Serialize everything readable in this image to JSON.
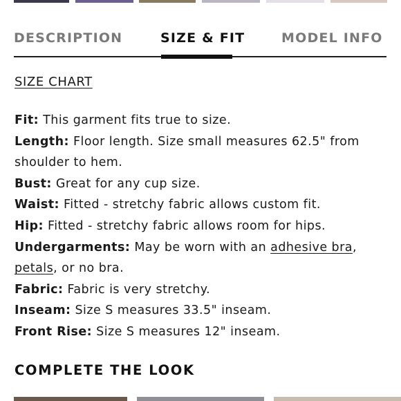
{
  "tabs": {
    "description": "DESCRIPTION",
    "size_fit": "SIZE & FIT",
    "model_info": "MODEL INFO",
    "active": "size_fit"
  },
  "size_chart_link": "SIZE CHART",
  "details": {
    "fit": {
      "label": "Fit:",
      "text": "This garment fits true to size."
    },
    "length": {
      "label": "Length:",
      "text_line1": "Floor length. Size small measures 62.5\" from",
      "text_line2": "shoulder to hem."
    },
    "bust": {
      "label": "Bust:",
      "text": "Great for any cup size."
    },
    "waist": {
      "label": "Waist:",
      "text": "Fitted - stretchy fabric allows custom fit."
    },
    "hip": {
      "label": "Hip:",
      "text": "Fitted - stretchy fabric allows room for hips."
    },
    "undergarments": {
      "label": "Undergarments:",
      "text_before": "May be worn with an",
      "link1": "adhesive bra",
      "sep": ",",
      "link2": "petals",
      "text_after": ", or no bra."
    },
    "fabric": {
      "label": "Fabric:",
      "text": "Fabric is very stretchy."
    },
    "inseam": {
      "label": "Inseam:",
      "text": "Size S measures 33.5\" inseam."
    },
    "front_rise": {
      "label": "Front Rise:",
      "text": "Size S measures 12\" inseam."
    }
  },
  "complete_the_look": "COMPLETE THE LOOK"
}
